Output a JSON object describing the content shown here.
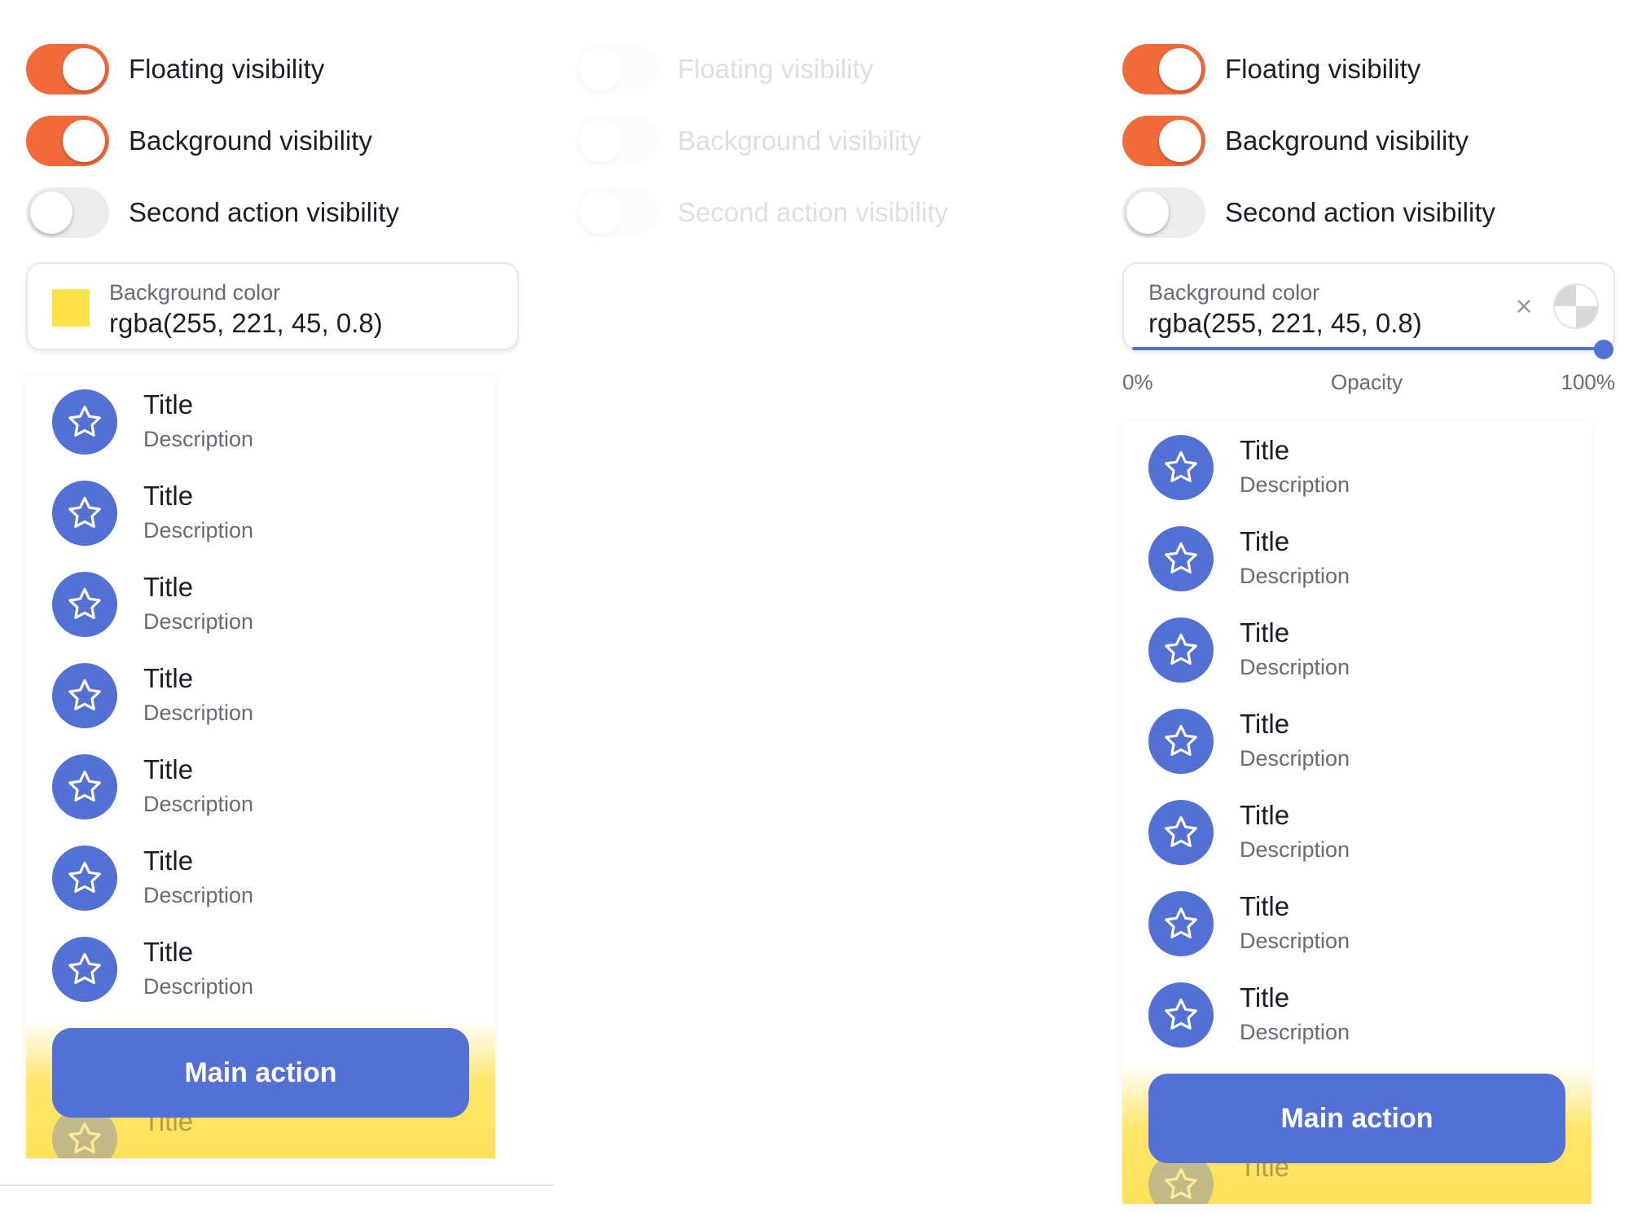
{
  "panels": [
    {
      "toggles": [
        {
          "label": "Floating visibility",
          "on": true
        },
        {
          "label": "Background visibility",
          "on": true
        },
        {
          "label": "Second action visibility",
          "on": false
        }
      ],
      "color_field": {
        "label": "Background color",
        "value": "rgba(255, 221, 45, 0.8)",
        "swatch_color": "#ffe14a"
      },
      "list": {
        "items": [
          {
            "title": "Title",
            "description": "Description"
          },
          {
            "title": "Title",
            "description": "Description"
          },
          {
            "title": "Title",
            "description": "Description"
          },
          {
            "title": "Title",
            "description": "Description"
          },
          {
            "title": "Title",
            "description": "Description"
          },
          {
            "title": "Title",
            "description": "Description"
          },
          {
            "title": "Title",
            "description": "Description"
          }
        ],
        "peek_title": "Title",
        "main_action": "Main action"
      }
    },
    {
      "toggles": [
        {
          "label": "Floating visibility",
          "on": false
        },
        {
          "label": "Background visibility",
          "on": false
        },
        {
          "label": "Second action visibility",
          "on": false
        }
      ]
    },
    {
      "toggles": [
        {
          "label": "Floating visibility",
          "on": true
        },
        {
          "label": "Background visibility",
          "on": true
        },
        {
          "label": "Second action visibility",
          "on": false
        }
      ],
      "color_field": {
        "label": "Background color",
        "value": "rgba(255, 221, 45, 0.8)",
        "clear_icon": "close-icon",
        "picker_icon": "color-picker-icon"
      },
      "opacity": {
        "min_label": "0%",
        "label": "Opacity",
        "max_label": "100%",
        "value": 1.0
      },
      "list": {
        "items": [
          {
            "title": "Title",
            "description": "Description"
          },
          {
            "title": "Title",
            "description": "Description"
          },
          {
            "title": "Title",
            "description": "Description"
          },
          {
            "title": "Title",
            "description": "Description"
          },
          {
            "title": "Title",
            "description": "Description"
          },
          {
            "title": "Title",
            "description": "Description"
          },
          {
            "title": "Title",
            "description": "Description"
          }
        ],
        "peek_title": "Title",
        "main_action": "Main action"
      }
    }
  ],
  "colors": {
    "toggle_on": "#f36a3a",
    "accent": "#5370d4",
    "highlight": "#ffe15a"
  },
  "icons": {
    "list_avatar": "star-icon"
  }
}
